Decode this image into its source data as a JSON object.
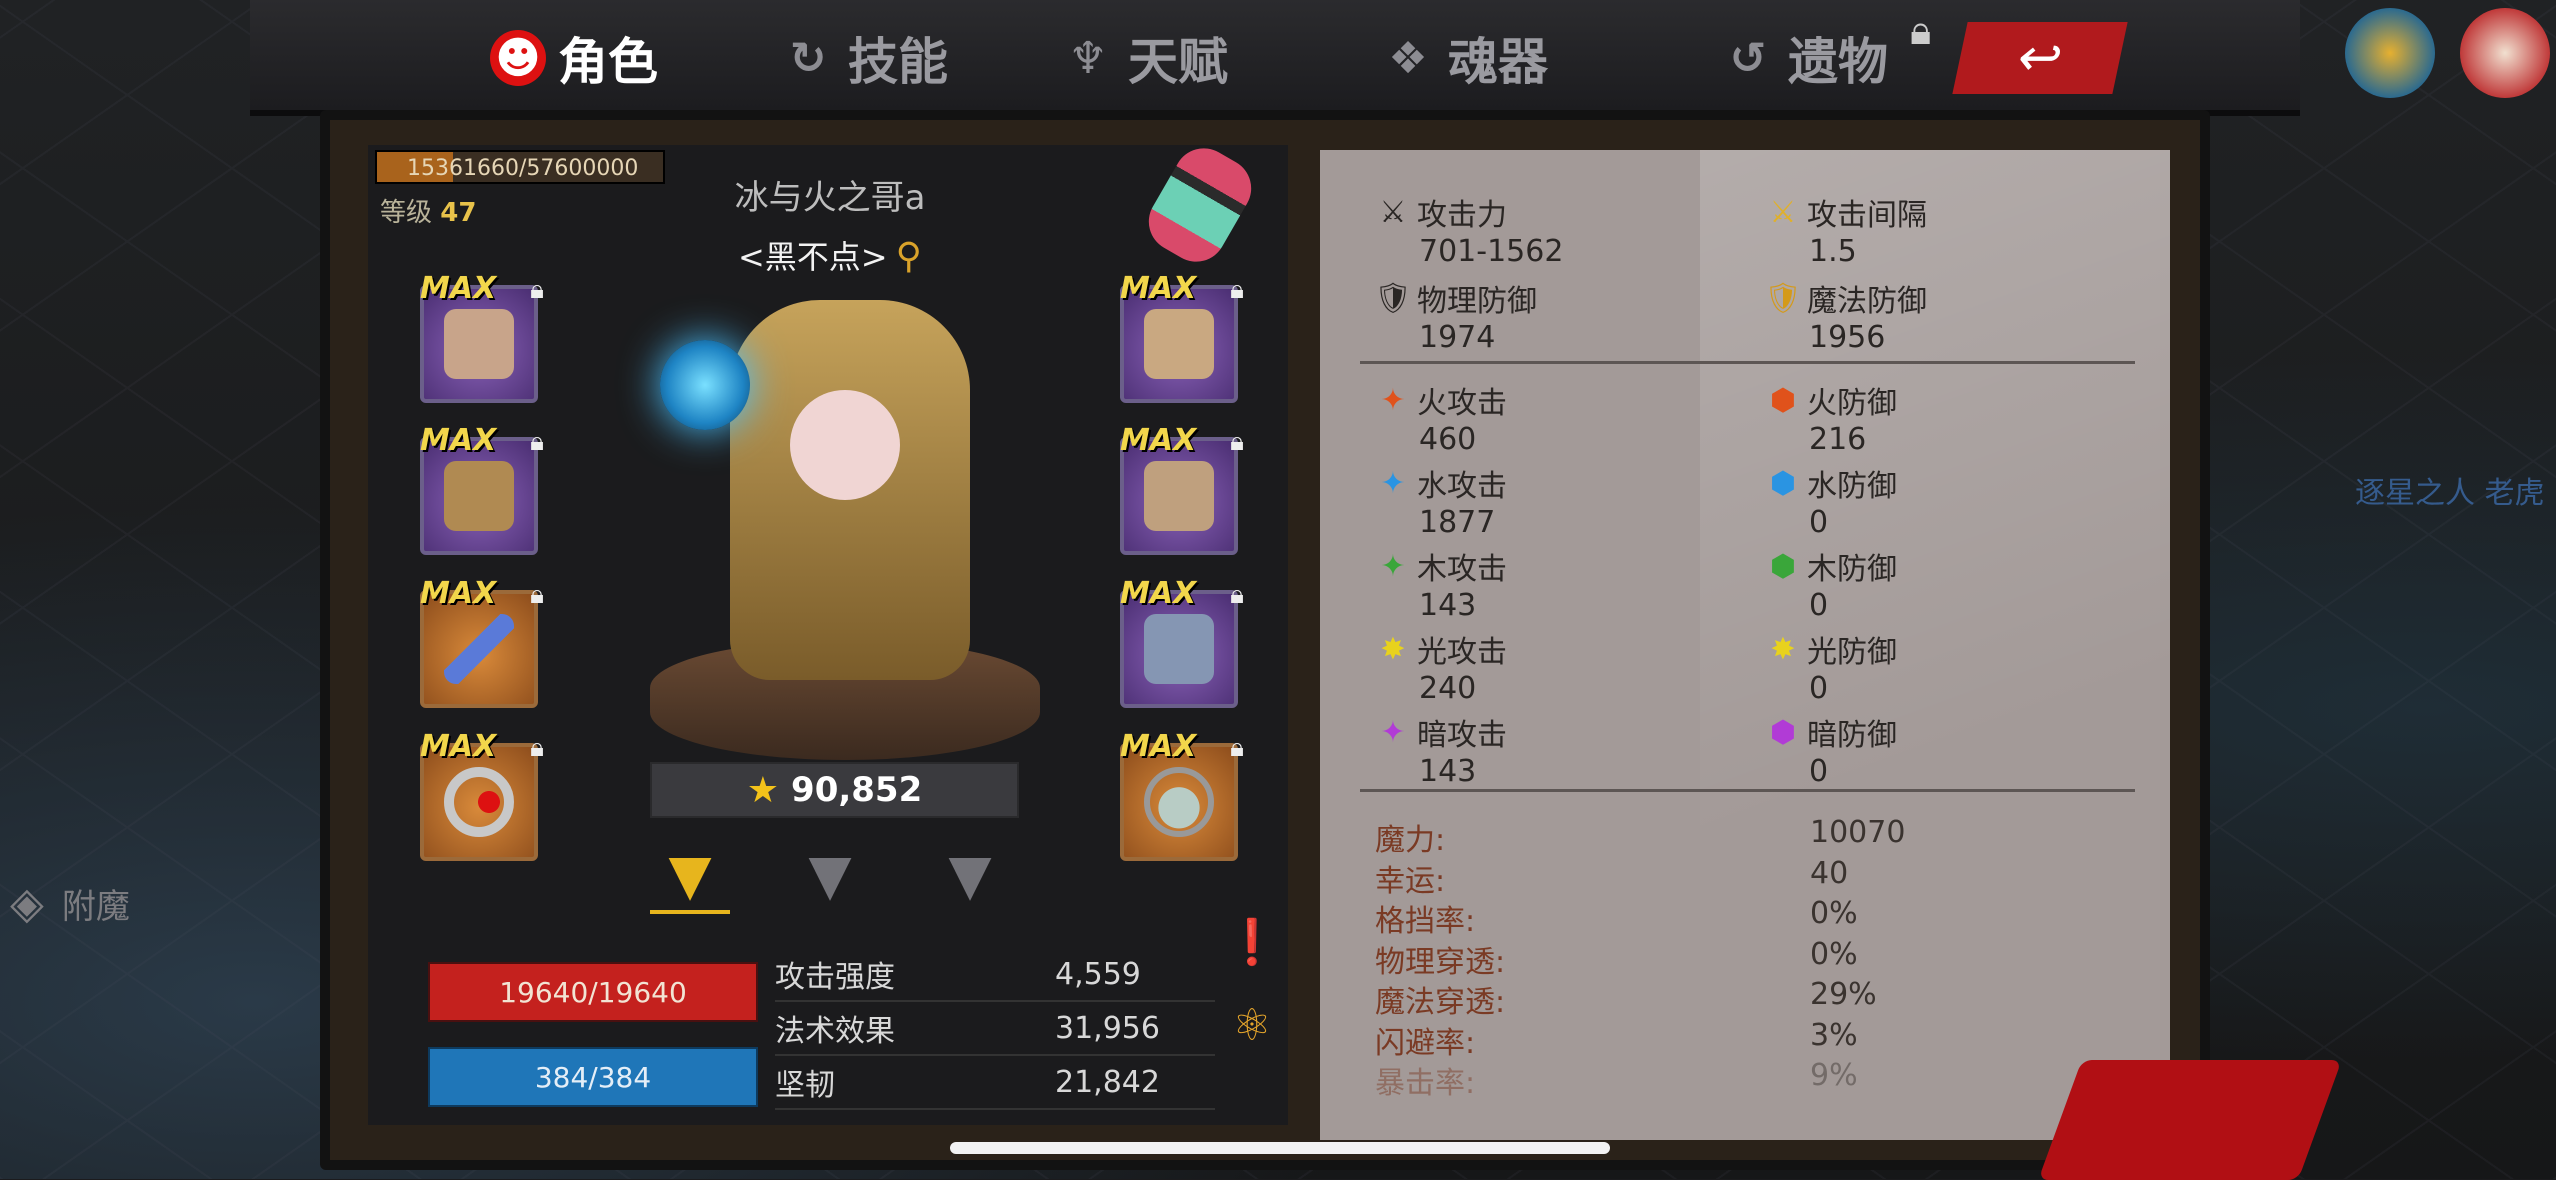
{
  "tabs": [
    {
      "label": "角色",
      "icon": "devil-face-icon",
      "active": true
    },
    {
      "label": "技能",
      "icon": "skill-swirl-icon",
      "active": false
    },
    {
      "label": "天赋",
      "icon": "talent-wings-icon",
      "active": false
    },
    {
      "label": "魂器",
      "icon": "soul-vessel-icon",
      "active": false
    },
    {
      "label": "遗物",
      "icon": "relic-swirl-icon",
      "active": false
    }
  ],
  "character": {
    "exp_text": "15361660/57600000",
    "exp_progress": 0.267,
    "level_label": "等级",
    "level_value": "47",
    "name": "冰与火之哥a",
    "guild": "<黑不点>",
    "power": "90,852"
  },
  "left_slots": [
    {
      "max": "MAX",
      "quality": "purple"
    },
    {
      "max": "MAX",
      "quality": "purple"
    },
    {
      "max": "MAX",
      "quality": "orange"
    },
    {
      "max": "MAX",
      "quality": "orange"
    }
  ],
  "right_slots": [
    {
      "max": "MAX",
      "quality": "purple"
    },
    {
      "max": "MAX",
      "quality": "purple"
    },
    {
      "max": "MAX",
      "quality": "purple"
    },
    {
      "max": "MAX",
      "quality": "orange"
    }
  ],
  "hp": "19640/19640",
  "mp": "384/384",
  "sub_stats": [
    {
      "label": "攻击强度",
      "value": "4,559"
    },
    {
      "label": "法术效果",
      "value": "31,956"
    },
    {
      "label": "坚韧",
      "value": "21,842"
    }
  ],
  "stats_primary": [
    {
      "label": "攻击力",
      "value": "701-1562",
      "icon": "sword-icon"
    },
    {
      "label": "攻击间隔",
      "value": "1.5",
      "icon": "quick-sword-icon"
    },
    {
      "label": "物理防御",
      "value": "1974",
      "icon": "armor-sword-icon"
    },
    {
      "label": "魔法防御",
      "value": "1956",
      "icon": "magic-shield-icon"
    }
  ],
  "stats_element": [
    {
      "atk_label": "火攻击",
      "atk_value": "460",
      "def_label": "火防御",
      "def_value": "216",
      "color": "#e0521b"
    },
    {
      "atk_label": "水攻击",
      "atk_value": "1877",
      "def_label": "水防御",
      "def_value": "0",
      "color": "#2a94e2"
    },
    {
      "atk_label": "木攻击",
      "atk_value": "143",
      "def_label": "木防御",
      "def_value": "0",
      "color": "#3aa63a"
    },
    {
      "atk_label": "光攻击",
      "atk_value": "240",
      "def_label": "光防御",
      "def_value": "0",
      "color": "#e8d21d"
    },
    {
      "atk_label": "暗攻击",
      "atk_value": "143",
      "def_label": "暗防御",
      "def_value": "0",
      "color": "#b13bd6"
    }
  ],
  "attributes": [
    {
      "label": "魔力:",
      "value": "10070"
    },
    {
      "label": "幸运:",
      "value": "40"
    },
    {
      "label": "格挡率:",
      "value": "0%"
    },
    {
      "label": "物理穿透:",
      "value": "0%"
    },
    {
      "label": "魔法穿透:",
      "value": "29%"
    },
    {
      "label": "闪避率:",
      "value": "3%"
    },
    {
      "label": "暴击率:",
      "value": "9%"
    }
  ],
  "enchant_label": "附魔",
  "side_text": "逐星之人 老虎"
}
